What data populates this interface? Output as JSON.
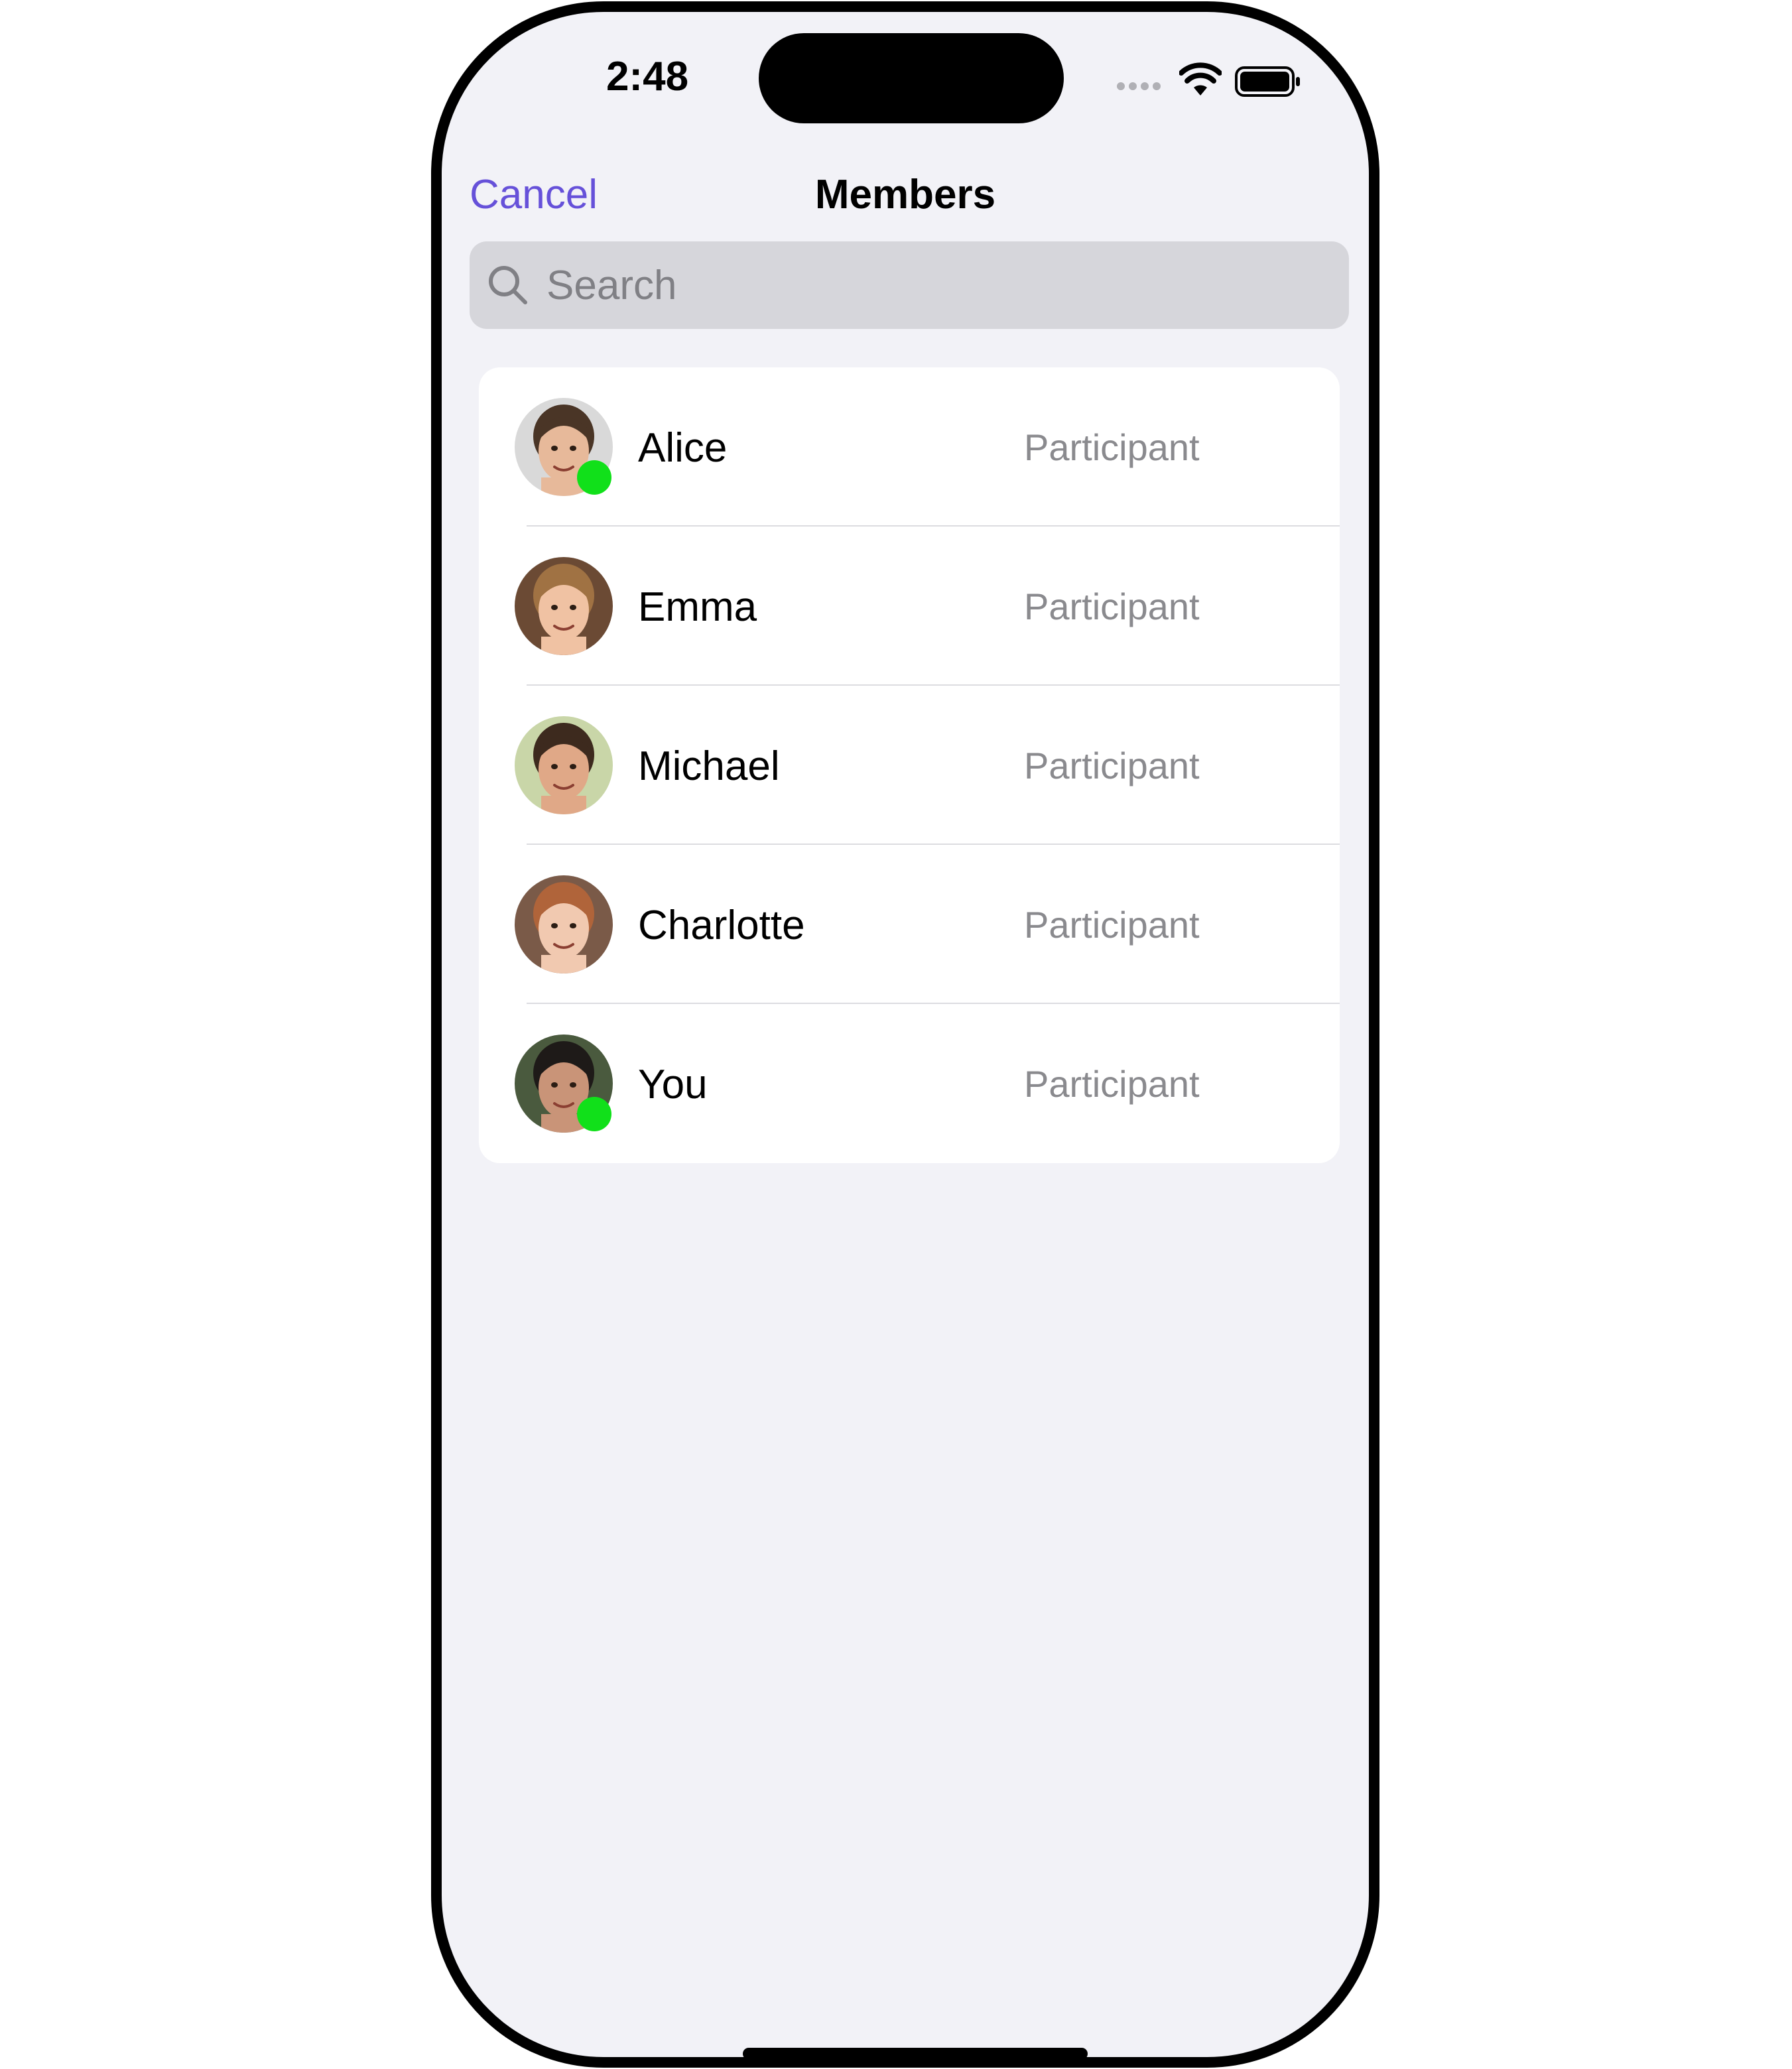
{
  "status_bar": {
    "time": "2:48",
    "icons": [
      "signal-icon",
      "wifi-icon",
      "battery-icon"
    ]
  },
  "nav": {
    "cancel_label": "Cancel",
    "title": "Members"
  },
  "search": {
    "placeholder": "Search",
    "value": ""
  },
  "members": [
    {
      "name": "Alice",
      "role": "Participant",
      "online": true,
      "avatar": {
        "skin": "#e7b99a",
        "hair": "#4a3526",
        "bg": "#d9d9d9"
      }
    },
    {
      "name": "Emma",
      "role": "Participant",
      "online": false,
      "avatar": {
        "skin": "#f0c2a3",
        "hair": "#a07243",
        "bg": "#6b4a34"
      }
    },
    {
      "name": "Michael",
      "role": "Participant",
      "online": false,
      "avatar": {
        "skin": "#e0a887",
        "hair": "#3d2a1e",
        "bg": "#c9d6a8"
      }
    },
    {
      "name": "Charlotte",
      "role": "Participant",
      "online": false,
      "avatar": {
        "skin": "#f1c9b0",
        "hair": "#b0643a",
        "bg": "#7a5a48"
      }
    },
    {
      "name": "You",
      "role": "Participant",
      "online": true,
      "avatar": {
        "skin": "#c99478",
        "hair": "#1e1a18",
        "bg": "#4a5a3e"
      }
    }
  ],
  "colors": {
    "accent": "#6651d9",
    "online": "#11e01a",
    "background": "#f2f2f7",
    "secondary_text": "#8a8a8e"
  }
}
